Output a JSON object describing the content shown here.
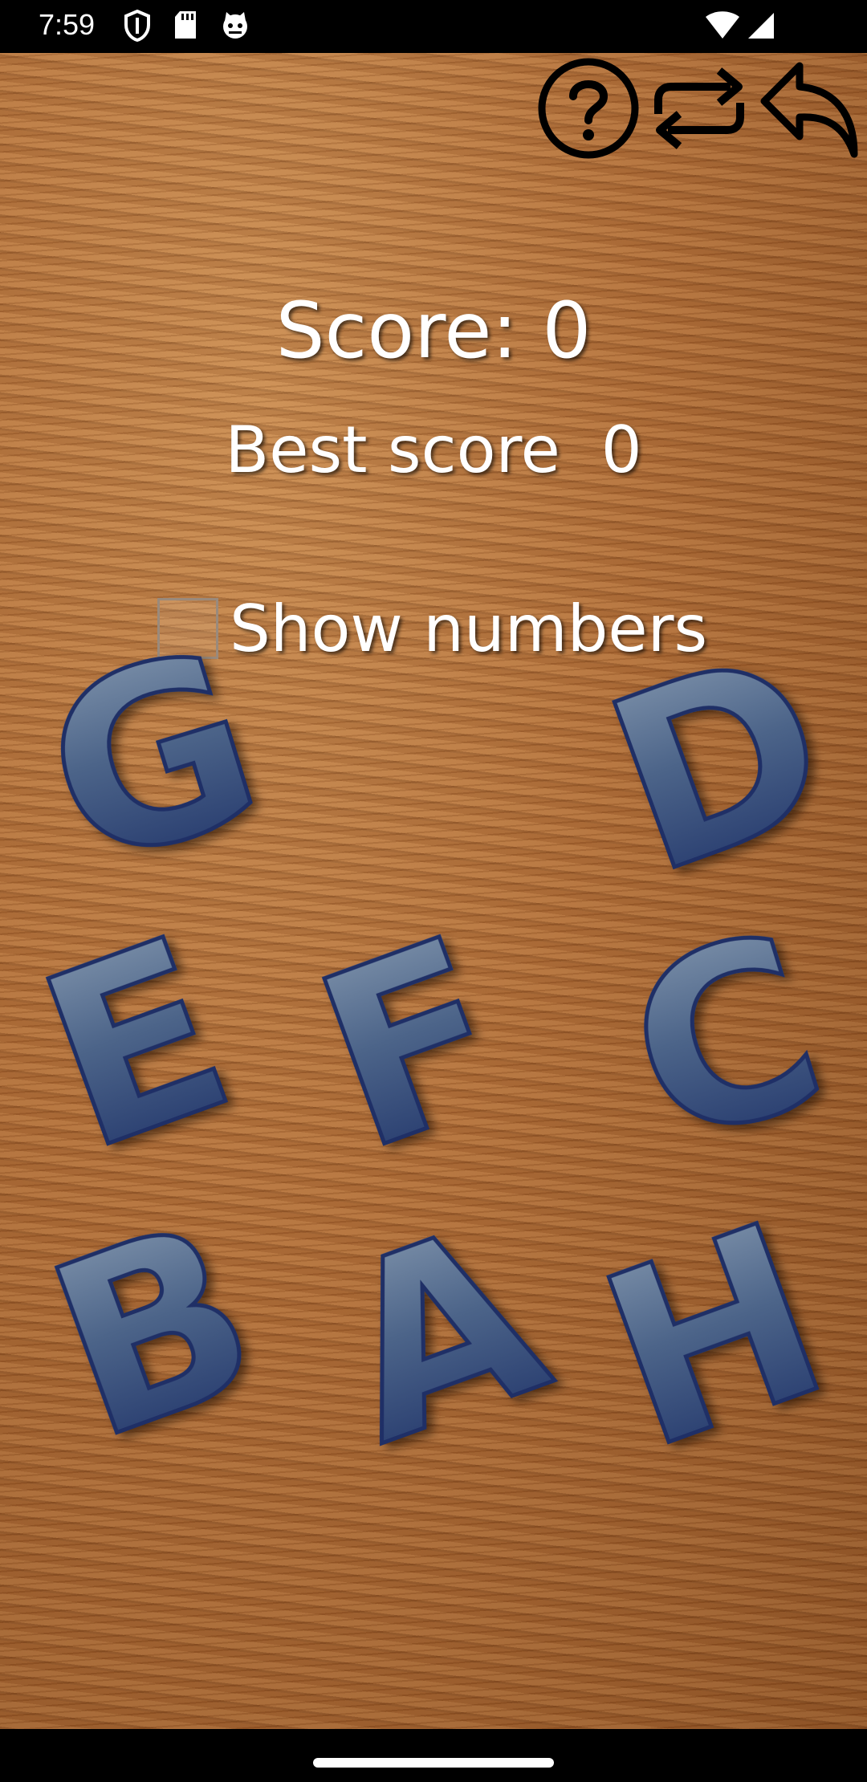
{
  "status_bar": {
    "time": "7:59",
    "icons": [
      "shield-icon",
      "sd-card-icon",
      "cat-face-icon",
      "wifi-icon",
      "cellular-signal-icon"
    ]
  },
  "toolbar": {
    "buttons": [
      "help-icon",
      "restart-icon",
      "back-icon"
    ]
  },
  "score": {
    "label": "Score: 0",
    "best_label": "Best score  0"
  },
  "options": {
    "show_numbers_label": "Show numbers",
    "show_numbers_checked": false
  },
  "tiles": [
    "G",
    "D",
    "E",
    "F",
    "C",
    "B",
    "A",
    "H"
  ],
  "colors": {
    "tile_fill_top": "#7f93ab",
    "tile_fill_bottom": "#22366b",
    "wood": "#b06c35",
    "text": "#ffffff"
  }
}
